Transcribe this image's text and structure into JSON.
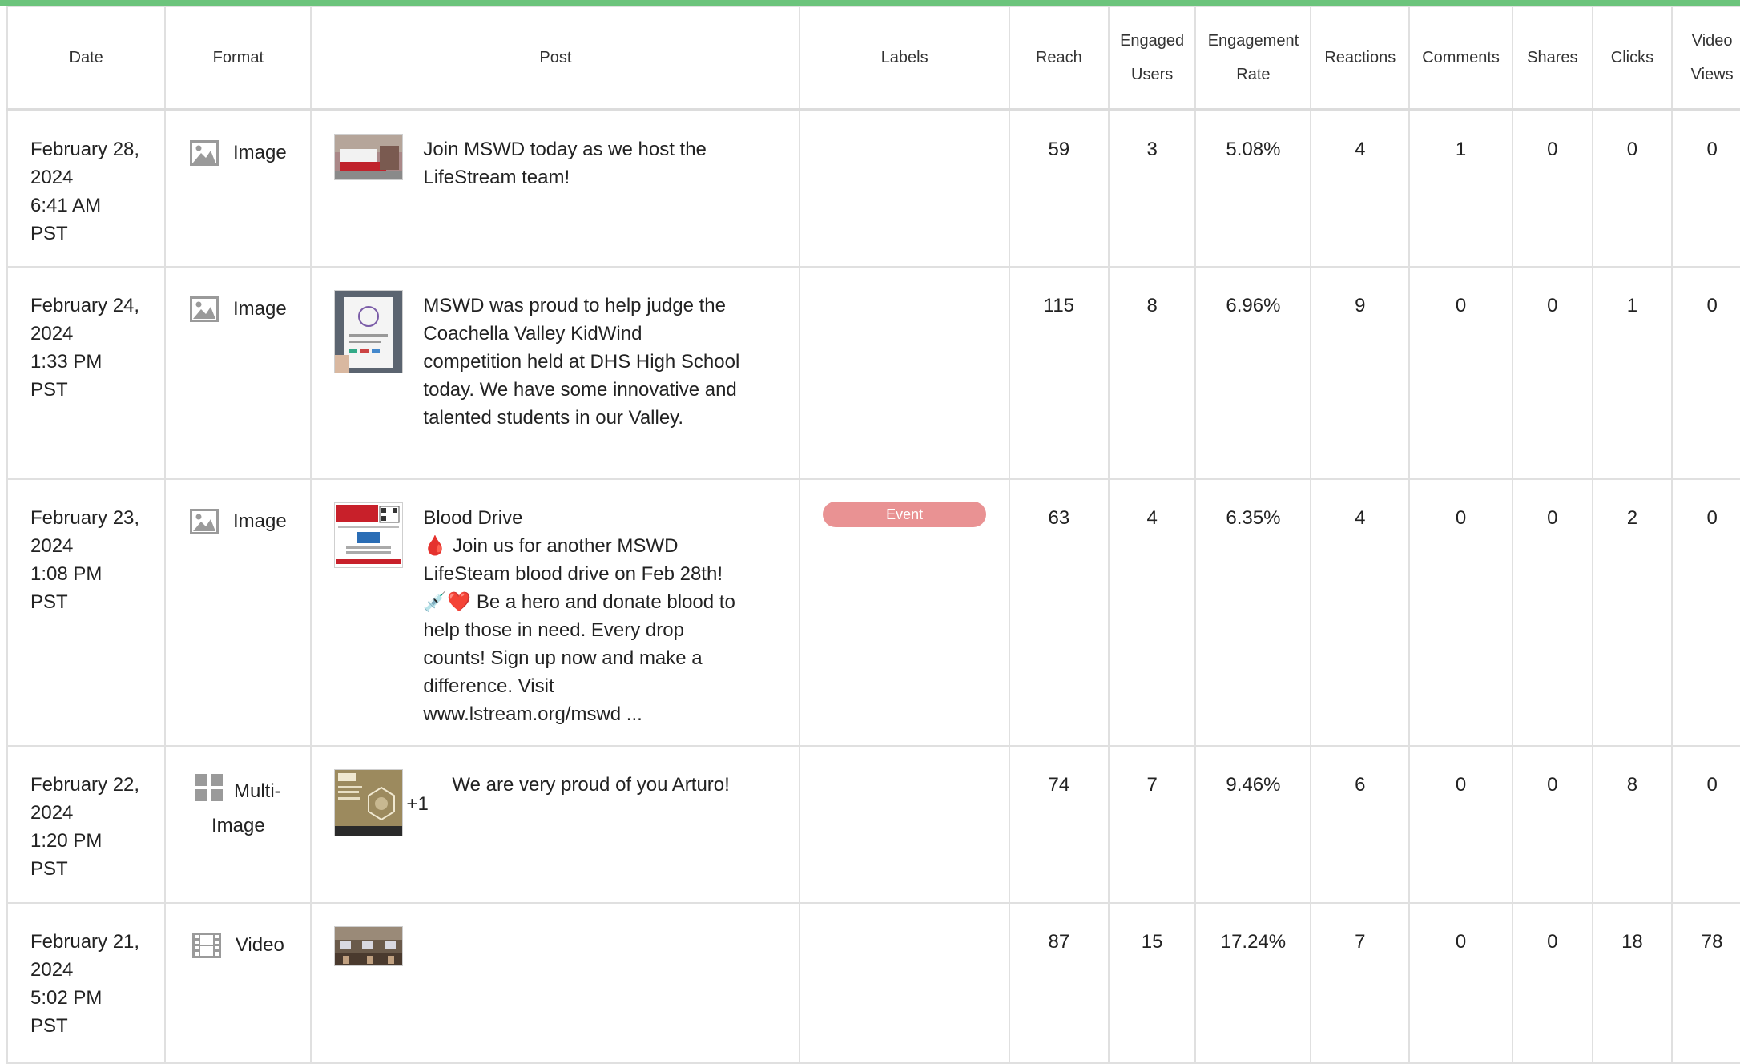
{
  "columns": [
    "Date",
    "Format",
    "Post",
    "Labels",
    "Reach",
    "Engaged Users",
    "Engagement Rate",
    "Reactions",
    "Comments",
    "Shares",
    "Clicks",
    "Video Views"
  ],
  "rows": [
    {
      "date_line1": "February 28,",
      "date_line2": "2024",
      "time": "6:41 AM",
      "tz": "PST",
      "format_icon": "image-icon",
      "format": "Image",
      "post_text": "Join MSWD today as we host the LifeStream team!",
      "label": "",
      "reach": "59",
      "engaged_users": "3",
      "engagement_rate": "5.08%",
      "reactions": "4",
      "comments": "1",
      "shares": "0",
      "clicks": "0",
      "video_views": "0"
    },
    {
      "date_line1": "February 24,",
      "date_line2": "2024",
      "time": "1:33 PM",
      "tz": "PST",
      "format_icon": "image-icon",
      "format": "Image",
      "post_text": "MSWD was proud to help judge the Coachella Valley KidWind competition held at DHS High School today. We have some innovative and talented students in our Valley.",
      "label": "",
      "reach": "115",
      "engaged_users": "8",
      "engagement_rate": "6.96%",
      "reactions": "9",
      "comments": "0",
      "shares": "0",
      "clicks": "1",
      "video_views": "0"
    },
    {
      "date_line1": "February 23,",
      "date_line2": "2024",
      "time": "1:08 PM",
      "tz": "PST",
      "format_icon": "image-icon",
      "format": "Image",
      "post_title": "Blood Drive",
      "post_text": "🩸 Join us for another MSWD LifeSteam blood drive on Feb 28th! 💉❤️ Be a hero and donate blood to help those in need. Every drop counts! Sign up now and make a difference. Visit www.lstream.org/mswd ...",
      "label": "Event",
      "label_color": "#e99293",
      "reach": "63",
      "engaged_users": "4",
      "engagement_rate": "6.35%",
      "reactions": "4",
      "comments": "0",
      "shares": "0",
      "clicks": "2",
      "video_views": "0"
    },
    {
      "date_line1": "February 22,",
      "date_line2": "2024",
      "time": "1:20 PM",
      "tz": "PST",
      "format_icon": "grid-icon",
      "format_line1": "Multi-",
      "format_line2": "Image",
      "post_text": "We are very proud of you Arturo!",
      "post_extra": "+1",
      "label": "",
      "reach": "74",
      "engaged_users": "7",
      "engagement_rate": "9.46%",
      "reactions": "6",
      "comments": "0",
      "shares": "0",
      "clicks": "8",
      "video_views": "0"
    },
    {
      "date_line1": "February 21,",
      "date_line2": "2024",
      "time": "5:02 PM",
      "tz": "PST",
      "format_icon": "film-icon",
      "format": "Video",
      "post_text": "",
      "label": "",
      "reach": "87",
      "engaged_users": "15",
      "engagement_rate": "17.24%",
      "reactions": "7",
      "comments": "0",
      "shares": "0",
      "clicks": "18",
      "video_views": "78"
    }
  ],
  "accent_color": "#6cc47c"
}
